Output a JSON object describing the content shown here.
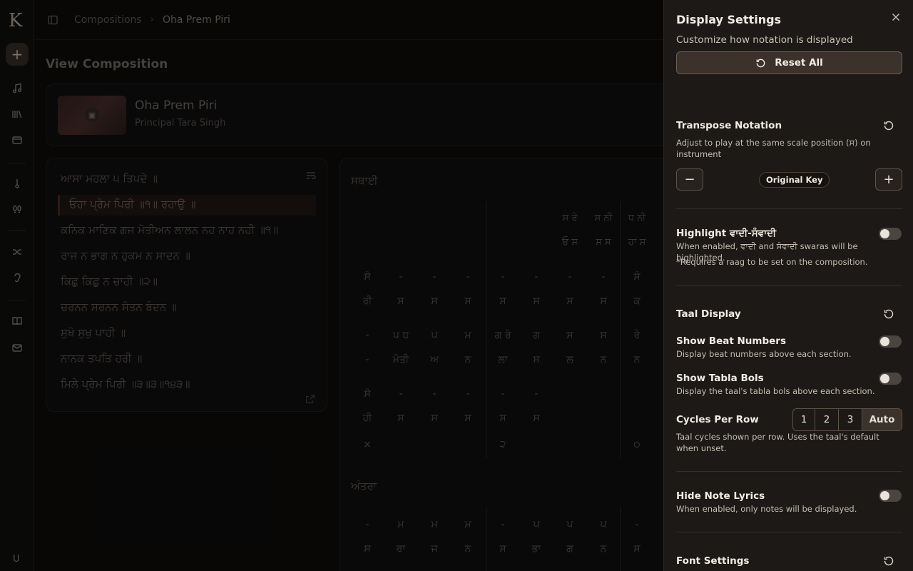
{
  "app": {
    "logo": "K",
    "user_initial": "U"
  },
  "breadcrumb": {
    "items": [
      "Compositions",
      "Oha Prem Piri"
    ]
  },
  "page": {
    "title": "View Composition"
  },
  "composition": {
    "title": "Oha Prem Piri",
    "author": "Principal Tara Singh"
  },
  "lyrics": {
    "lines": [
      "ਆਸਾ ਮਹਲਾ ੫ ਤਿਪਦੇ ॥",
      "ਓਹਾ ਪ੍ਰੇਮ ਪਿਰੀ ॥੧॥ ਰਹਾਉ ॥",
      "ਕਨਿਕ ਮਾਣਿਕ ਗਜ ਮੋਤੀਅਨ ਲਾਲਨ ਨਹ ਨਾਹ ਨਹੀ ॥੧॥",
      "ਰਾਜ ਨ ਭਾਗ ਨ ਹੁਕਮ ਨ ਸਾਦਨ ॥",
      "ਕਿਛੁ ਕਿਛੁ ਨ ਚਾਹੀ ॥੨॥",
      "ਚਰਨਨ ਸਰਨਨ ਸੰਤਨ ਬੰਦਨ ॥",
      "ਸੁਖੋ ਸੁਖੁ ਪਾਹੀ ॥",
      "ਨਾਨਕ ਤਪਤਿ ਹਰੀ ॥",
      "ਮਿਲੇ ਪ੍ਰੇਮ ਪਿਰੀ ॥੩॥੩॥੧੪੩॥"
    ],
    "active_index": 1
  },
  "notation": {
    "sthai_label": "ਸਥਾਈ",
    "antara_label": "ਅੰਤਰਾ",
    "row0_notes": [
      "ਸ ਰੇ",
      "ਸ ਨੀ",
      "ਧ ਨੀ"
    ],
    "row0_lyrics": [
      "ਓ ਸ",
      "ਸ ਸ",
      "ਹਾ ਸ"
    ],
    "row1_notes": [
      "ਸੰ",
      "-",
      "-",
      "-",
      "-",
      "-",
      "-",
      "-",
      "ਸੰ"
    ],
    "row1_lyrics": [
      "ਰੀ",
      "ਸ",
      "ਸ",
      "ਸ",
      "ਸ",
      "ਸ",
      "ਸ",
      "ਸ",
      "ਕ"
    ],
    "row2_notes": [
      "-",
      "ਪ ਧ",
      "ਪ",
      "ਮ",
      "ਗ ਰੇ",
      "ਗ",
      "ਸ",
      "ਸ",
      "ਰੇ"
    ],
    "row2_lyrics": [
      "-",
      "ਮੋਤੀ",
      "ਅ",
      "ਨ",
      "ਲਾ",
      "ਸ",
      "ਲ",
      "ਨ",
      "ਨ"
    ],
    "row3_notes": [
      "ਸੰ",
      "-",
      "-",
      "-",
      "-",
      "-"
    ],
    "row3_lyrics": [
      "ਹੀ",
      "ਸ",
      "ਸ",
      "ਸ",
      "ਸ",
      "ਸ"
    ],
    "taal_marks": [
      "×",
      "੨",
      "੦"
    ],
    "row4_notes": [
      "-",
      "ਮ",
      "ਮ",
      "ਮ",
      "-",
      "ਪ",
      "ਪ",
      "ਪ",
      "-"
    ],
    "row4_lyrics": [
      "ਸ",
      "ਰਾ",
      "ਜ",
      "ਨ",
      "ਸ",
      "ਭਾ",
      "ਗ",
      "ਨ",
      "ਸ"
    ]
  },
  "settings": {
    "title": "Display Settings",
    "subtitle": "Customize how notation is displayed",
    "reset_all": "Reset All",
    "transpose": {
      "title": "Transpose Notation",
      "description": "Adjust to play at the same scale position (ਸ) on instrument",
      "key_label": "Original Key",
      "decrease": "−",
      "increase": "+"
    },
    "highlight": {
      "title": "Highlight ਵਾਦੀ-ਸੰਵਾਦੀ",
      "description": "When enabled, ਵਾਦੀ and ਸੰਵਾਦੀ swaras will be highlighted.",
      "note": "*Requires a raag to be set on the composition.",
      "enabled": false
    },
    "taal": {
      "title": "Taal Display",
      "beat_numbers": {
        "title": "Show Beat Numbers",
        "description": "Display beat numbers above each section.",
        "enabled": false
      },
      "tabla_bols": {
        "title": "Show Tabla Bols",
        "description": "Display the taal's tabla bols above each section.",
        "enabled": false
      },
      "cycles": {
        "title": "Cycles Per Row",
        "options": [
          "1",
          "2",
          "3",
          "Auto"
        ],
        "selected": "Auto",
        "description": "Taal cycles shown per row. Uses the taal's default when unset."
      }
    },
    "hide_lyrics": {
      "title": "Hide Note Lyrics",
      "description": "When enabled, only notes will be displayed.",
      "enabled": false
    },
    "font": {
      "title": "Font Settings"
    }
  },
  "colors": {
    "panel_bg": "#1c1916",
    "accent_button": "#3a322b",
    "app_bg": "#0b0a09"
  }
}
